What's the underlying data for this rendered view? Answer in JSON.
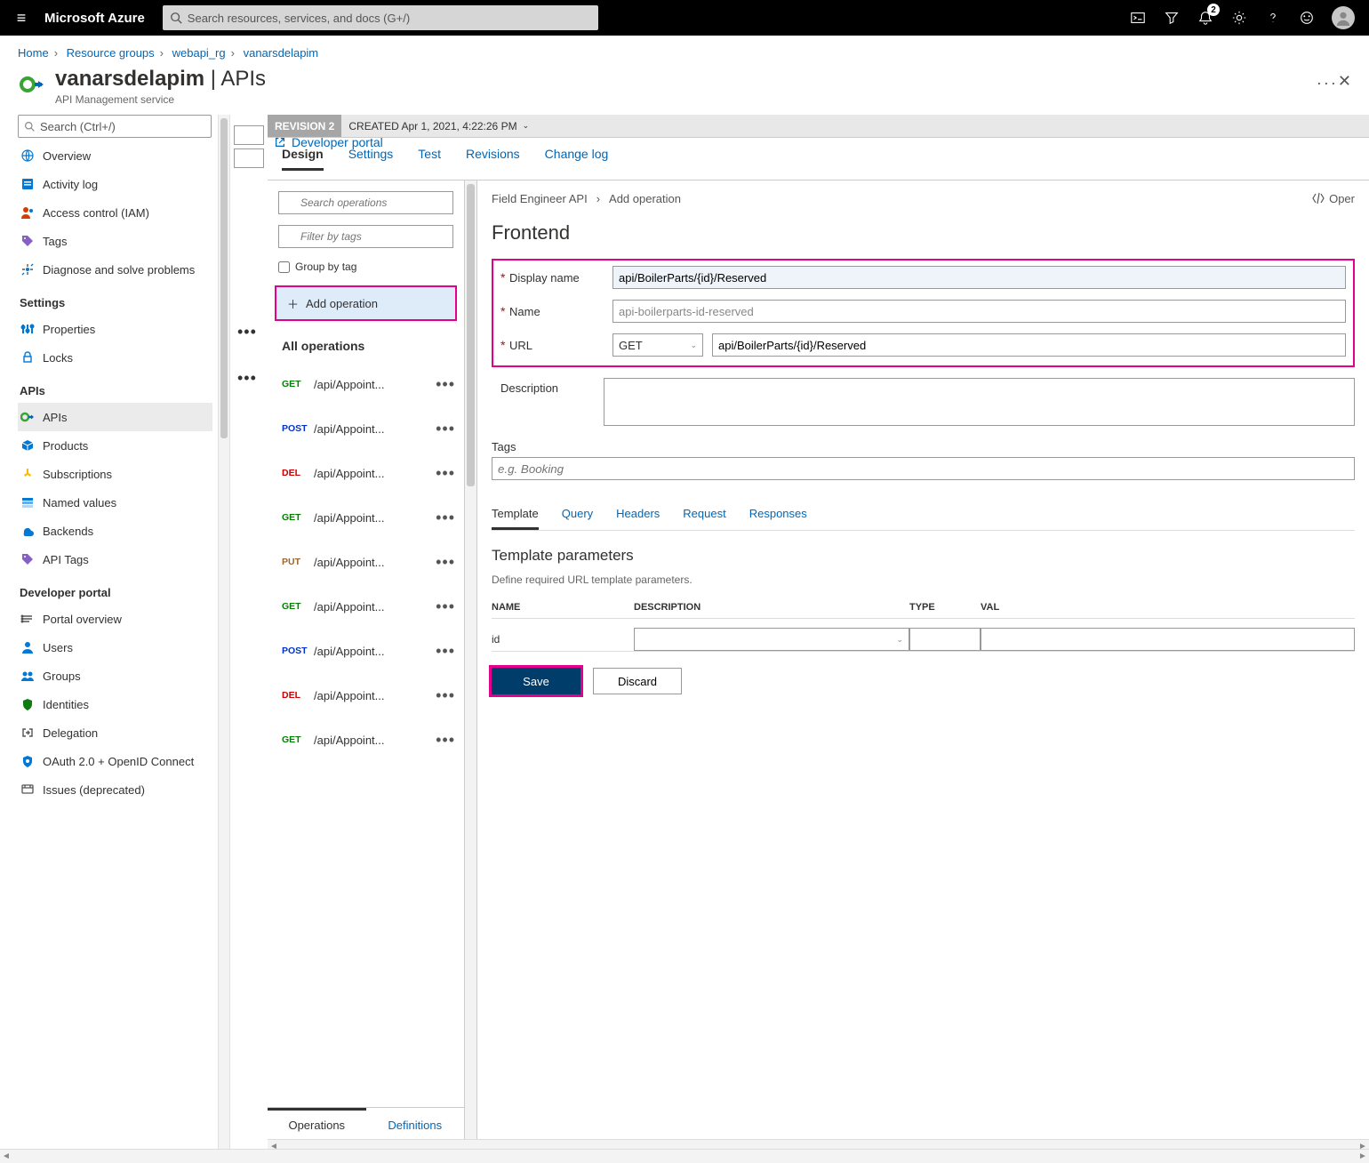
{
  "topbar": {
    "brand": "Microsoft Azure",
    "search_placeholder": "Search resources, services, and docs (G+/)",
    "notification_badge": "2"
  },
  "breadcrumbs": [
    {
      "label": "Home",
      "link": true
    },
    {
      "label": "Resource groups",
      "link": true
    },
    {
      "label": "webapi_rg",
      "link": true
    },
    {
      "label": "vanarsdelapim",
      "link": true
    }
  ],
  "page_header": {
    "title_main": "vanarsdelapim",
    "title_sub": "APIs",
    "subtitle": "API Management service"
  },
  "developer_portal_link": "Developer portal",
  "side_search_placeholder": "Search (Ctrl+/)",
  "sidebar": {
    "top": [
      {
        "label": "Overview",
        "icon": "globe"
      },
      {
        "label": "Activity log",
        "icon": "log"
      },
      {
        "label": "Access control (IAM)",
        "icon": "iam"
      },
      {
        "label": "Tags",
        "icon": "tag"
      },
      {
        "label": "Diagnose and solve problems",
        "icon": "diagnose"
      }
    ],
    "groups": [
      {
        "title": "Settings",
        "items": [
          {
            "label": "Properties",
            "icon": "props"
          },
          {
            "label": "Locks",
            "icon": "lock"
          }
        ]
      },
      {
        "title": "APIs",
        "items": [
          {
            "label": "APIs",
            "icon": "api",
            "active": true
          },
          {
            "label": "Products",
            "icon": "products"
          },
          {
            "label": "Subscriptions",
            "icon": "subs"
          },
          {
            "label": "Named values",
            "icon": "named"
          },
          {
            "label": "Backends",
            "icon": "backends"
          },
          {
            "label": "API Tags",
            "icon": "apitags"
          }
        ]
      },
      {
        "title": "Developer portal",
        "items": [
          {
            "label": "Portal overview",
            "icon": "portal"
          },
          {
            "label": "Users",
            "icon": "users"
          },
          {
            "label": "Groups",
            "icon": "groups"
          },
          {
            "label": "Identities",
            "icon": "ident"
          },
          {
            "label": "Delegation",
            "icon": "deleg"
          },
          {
            "label": "OAuth 2.0 + OpenID Connect",
            "icon": "oauth"
          },
          {
            "label": "Issues (deprecated)",
            "icon": "issues"
          }
        ]
      }
    ]
  },
  "revision": {
    "label": "REVISION 2",
    "created": "CREATED Apr 1, 2021, 4:22:26 PM"
  },
  "design_tabs": [
    "Design",
    "Settings",
    "Test",
    "Revisions",
    "Change log"
  ],
  "design_tabs_active": 0,
  "op_search_placeholder": "Search operations",
  "op_filter_placeholder": "Filter by tags",
  "group_by_tag": "Group by tag",
  "add_operation": "Add operation",
  "all_operations": "All operations",
  "operations": [
    {
      "verb": "GET",
      "path": "/api/Appoint..."
    },
    {
      "verb": "POST",
      "path": "/api/Appoint..."
    },
    {
      "verb": "DEL",
      "path": "/api/Appoint..."
    },
    {
      "verb": "GET",
      "path": "/api/Appoint..."
    },
    {
      "verb": "PUT",
      "path": "/api/Appoint..."
    },
    {
      "verb": "GET",
      "path": "/api/Appoint..."
    },
    {
      "verb": "POST",
      "path": "/api/Appoint..."
    },
    {
      "verb": "DEL",
      "path": "/api/Appoint..."
    },
    {
      "verb": "GET",
      "path": "/api/Appoint..."
    }
  ],
  "bottom_tabs": {
    "ops": "Operations",
    "defs": "Definitions"
  },
  "detail_crumb": {
    "api": "Field Engineer API",
    "action": "Add operation",
    "openapi_lbl": "Oper"
  },
  "frontend": {
    "title": "Frontend",
    "labels": {
      "display_name": "Display name",
      "name": "Name",
      "url": "URL",
      "description": "Description"
    },
    "display_name_val": "api/BoilerParts/{id}/Reserved",
    "name_val": "api-boilerparts-id-reserved",
    "url_method": "GET",
    "url_val": "api/BoilerParts/{id}/Reserved",
    "tags_label": "Tags",
    "tags_placeholder": "e.g. Booking"
  },
  "sub_tabs": [
    "Template",
    "Query",
    "Headers",
    "Request",
    "Responses"
  ],
  "sub_tabs_active": 0,
  "template": {
    "title": "Template parameters",
    "desc": "Define required URL template parameters.",
    "cols": [
      "NAME",
      "DESCRIPTION",
      "TYPE",
      "VAL"
    ],
    "rows": [
      {
        "name": "id"
      }
    ]
  },
  "buttons": {
    "save": "Save",
    "discard": "Discard"
  }
}
